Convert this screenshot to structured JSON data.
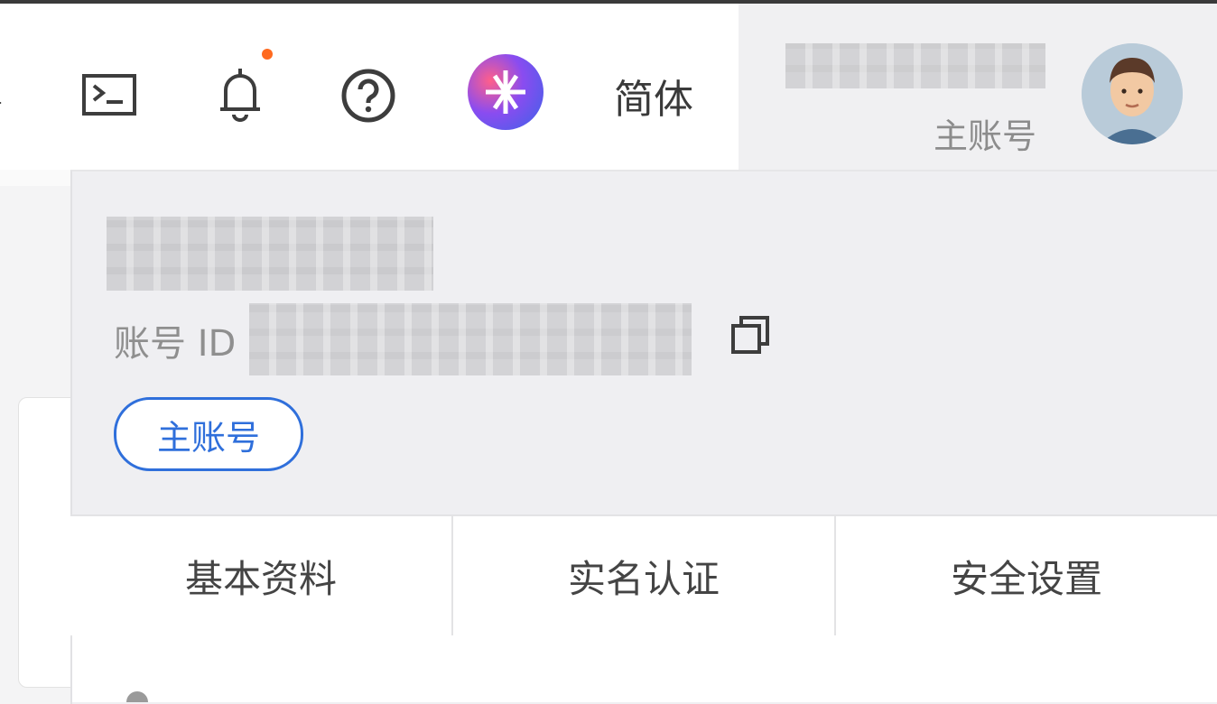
{
  "header": {
    "terminal_icon": "terminal-icon",
    "bell_icon": "bell-icon",
    "help_icon": "help-icon",
    "ai_icon": "ai-assistant-icon",
    "language": "简体",
    "account_role": "主账号",
    "notification_dot_color": "#ff6a1f"
  },
  "account_panel": {
    "account_id_label": "账号 ID",
    "role_tag": "主账号",
    "copy_icon": "copy-icon",
    "tabs": [
      {
        "label": "基本资料"
      },
      {
        "label": "实名认证"
      },
      {
        "label": "安全设置"
      }
    ]
  },
  "colors": {
    "accent_blue": "#2f6fdb"
  }
}
